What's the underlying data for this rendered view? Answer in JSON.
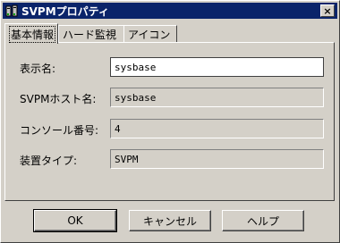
{
  "window": {
    "title": "SVPMプロパティ",
    "close_label": "×"
  },
  "tabs": [
    {
      "label": "基本情報",
      "active": true
    },
    {
      "label": "ハード監視",
      "active": false
    },
    {
      "label": "アイコン",
      "active": false
    }
  ],
  "fields": [
    {
      "label": "表示名:",
      "value": "sysbase",
      "editable": true
    },
    {
      "label": "SVPMホスト名:",
      "value": "sysbase",
      "editable": false
    },
    {
      "label": "コンソール番号:",
      "value": "4",
      "editable": false
    },
    {
      "label": "装置タイプ:",
      "value": "SVPM",
      "editable": false
    }
  ],
  "buttons": {
    "ok": "OK",
    "cancel": "キャンセル",
    "help": "ヘルプ"
  },
  "colors": {
    "titlebar": "#0a246a",
    "face": "#d4d0c8"
  },
  "icons": {
    "app": "server-app-icon"
  }
}
